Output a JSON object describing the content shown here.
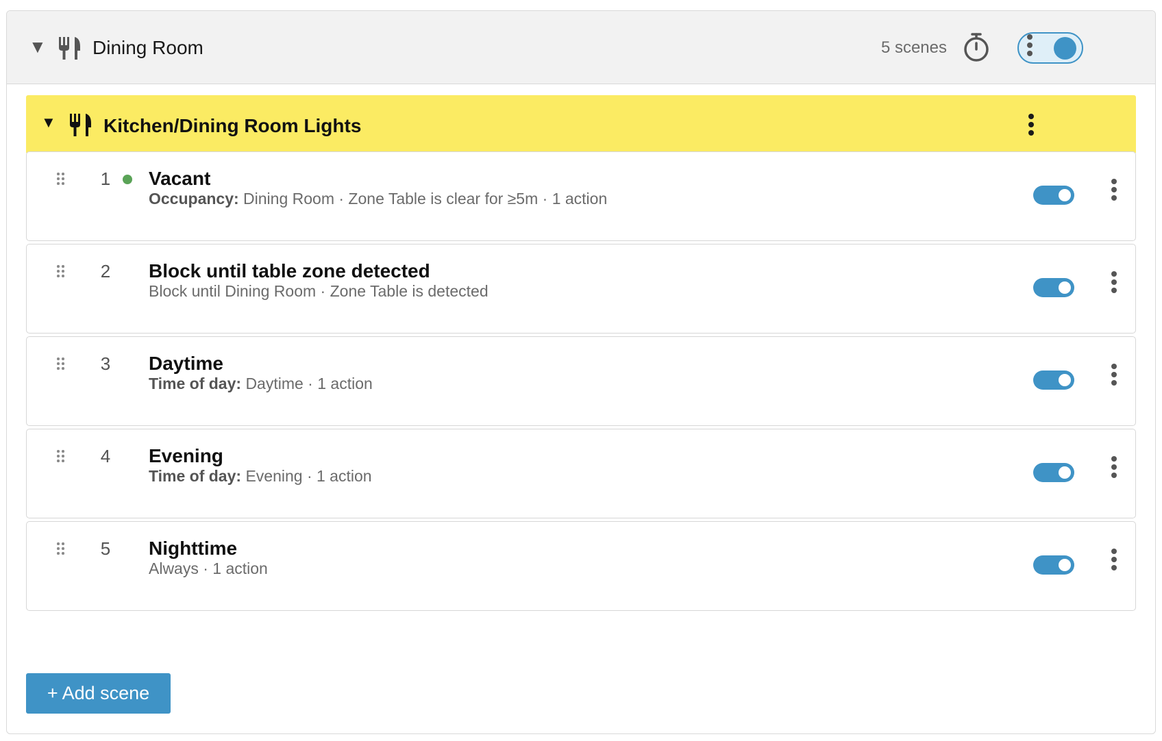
{
  "room": {
    "title": "Dining Room",
    "icon": "fork-knife-icon",
    "scene_count": "5 scenes",
    "enabled": true,
    "accent_color": "#3f93c6"
  },
  "group": {
    "title": "Kitchen/Dining Room Lights",
    "icon": "fork-knife-icon",
    "highlight_color": "#fbeb63"
  },
  "scenes": [
    {
      "number": "1",
      "name": "Vacant",
      "active": true,
      "condition_label": "Occupancy:",
      "condition_text": "Dining Room · Zone Table is clear for ≥5m · 1 action",
      "enabled": true
    },
    {
      "number": "2",
      "name": "Block until table zone detected",
      "active": false,
      "condition_label": "",
      "condition_text": "Block until Dining Room · Zone Table is detected",
      "enabled": true
    },
    {
      "number": "3",
      "name": "Daytime",
      "active": false,
      "condition_label": "Time of day:",
      "condition_text": "Daytime · 1 action",
      "enabled": true
    },
    {
      "number": "4",
      "name": "Evening",
      "active": false,
      "condition_label": "Time of day:",
      "condition_text": "Evening · 1 action",
      "enabled": true
    },
    {
      "number": "5",
      "name": "Nighttime",
      "active": false,
      "condition_label": "",
      "condition_text": "Always · 1 action",
      "enabled": true
    }
  ],
  "add_scene_label": "+ Add scene",
  "colors": {
    "active_dot": "#5aa357",
    "toggle_on": "#3f93c6"
  }
}
